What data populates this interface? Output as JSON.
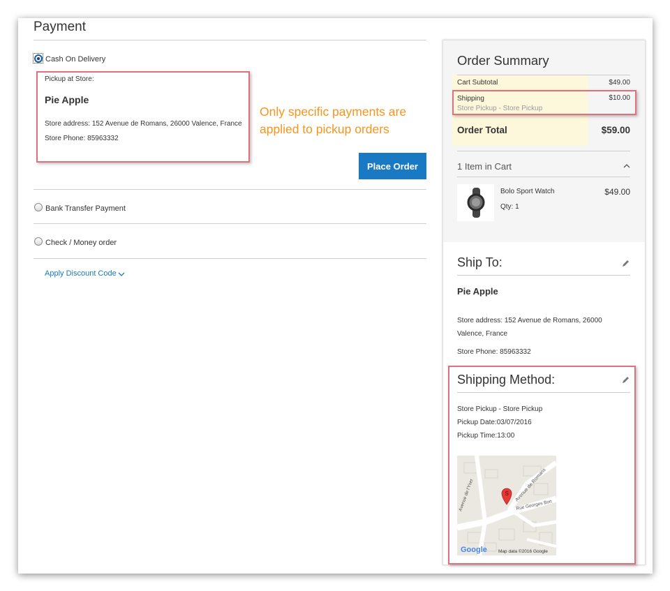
{
  "payment": {
    "title": "Payment",
    "methods": [
      {
        "label": "Cash On Delivery",
        "selected": true
      },
      {
        "label": "Bank Transfer Payment",
        "selected": false
      },
      {
        "label": "Check / Money order",
        "selected": false
      }
    ],
    "pickup": {
      "heading": "Pickup at Store:",
      "store_name": "Pie Apple",
      "address": "Store address: 152 Avenue de Romans, 26000 Valence, France",
      "phone": "Store Phone: 85963332"
    },
    "place_order_label": "Place Order",
    "discount_link": "Apply Discount Code"
  },
  "annotation": {
    "line1": "Only specific payments are",
    "line2": "applied to pickup orders"
  },
  "summary": {
    "title": "Order Summary",
    "cart_subtotal_label": "Cart Subtotal",
    "cart_subtotal_value": "$49.00",
    "shipping_label": "Shipping",
    "shipping_value": "$10.00",
    "shipping_method": "Store Pickup - Store Pickup",
    "order_total_label": "Order Total",
    "order_total_value": "$59.00",
    "items_in_cart": "1 Item in Cart",
    "item": {
      "name": "Bolo Sport Watch",
      "qty": "Qty: 1",
      "price": "$49.00"
    }
  },
  "ship_to": {
    "title": "Ship To:",
    "name": "Pie Apple",
    "address_line1": "Store address: 152 Avenue de Romans, 26000",
    "address_line2": "Valence, France",
    "phone": "Store Phone: 85963332"
  },
  "shipping_method": {
    "title": "Shipping Method:",
    "method": "Store Pickup - Store Pickup",
    "date": "Pickup Date:03/07/2016",
    "time": "Pickup Time:13:00"
  },
  "map": {
    "streets": [
      "Avenue de Romans",
      "Rue Georges Bon",
      "Avenue de l'Yser"
    ],
    "marker_label": "S",
    "brand": "Google",
    "attribution": "Map data ©2016 Google"
  },
  "colors": {
    "accent": "#1979c3",
    "annotation": "#f7941d",
    "highlight_border": "#e0707d",
    "summary_highlight": "#fdf8dc"
  }
}
